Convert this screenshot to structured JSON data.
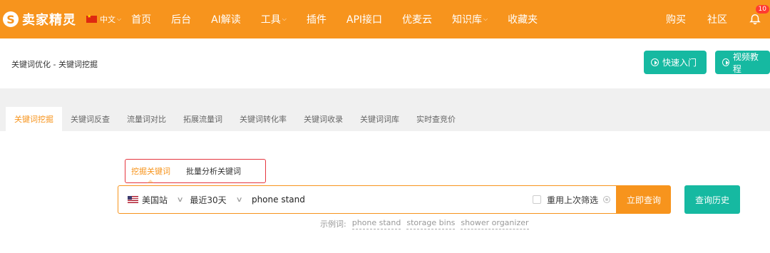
{
  "topbar": {
    "brand": "卖家精灵",
    "logo_letter": "S",
    "language": "中文",
    "nav": [
      "首页",
      "后台",
      "AI解读",
      "工具",
      "插件",
      "API接口",
      "优麦云",
      "知识库",
      "收藏夹"
    ],
    "right": {
      "buy": "购买",
      "community": "社区",
      "notification_count": "10"
    }
  },
  "header": {
    "breadcrumb": "关键词优化 - 关键词挖掘",
    "quick_start": "快速入门",
    "video_tutorial": "视频教程"
  },
  "tabs": [
    "关键词挖掘",
    "关键词反查",
    "流量词对比",
    "拓展流量词",
    "关键词转化率",
    "关键词收录",
    "关键词词库",
    "实时查竞价"
  ],
  "subtabs": [
    "挖掘关键词",
    "批量分析关键词"
  ],
  "search": {
    "marketplace": "美国站",
    "period": "最近30天",
    "query": "phone stand",
    "reuse_filter": "重用上次筛选",
    "submit": "立即查询",
    "history": "查询历史"
  },
  "examples": {
    "label": "示例词:",
    "items": [
      "phone stand",
      "storage bins",
      "shower organizer"
    ]
  },
  "colors": {
    "brand_orange": "#f7941d",
    "teal": "#16b9a1",
    "highlight_red": "#e5363f"
  }
}
